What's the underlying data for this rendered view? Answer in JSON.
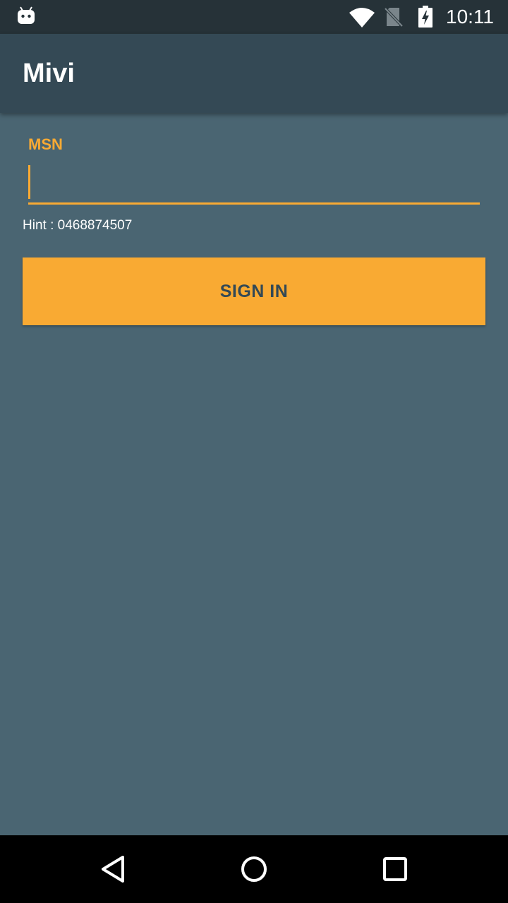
{
  "status_bar": {
    "time": "10:11",
    "icons": [
      "android-notification-icon",
      "wifi-icon",
      "no-sim-icon",
      "battery-charging-icon"
    ]
  },
  "app_bar": {
    "title": "Mivi"
  },
  "login_form": {
    "field_label": "MSN",
    "msn_value": "",
    "hint": "Hint : 0468874507",
    "sign_in_label": "SIGN IN"
  },
  "nav_bar": {
    "icons": [
      "back-icon",
      "home-icon",
      "recents-icon"
    ]
  },
  "colors": {
    "accent": "#f9aa33",
    "primary": "#344955",
    "background": "#4a6572",
    "status_bar": "#263238"
  }
}
